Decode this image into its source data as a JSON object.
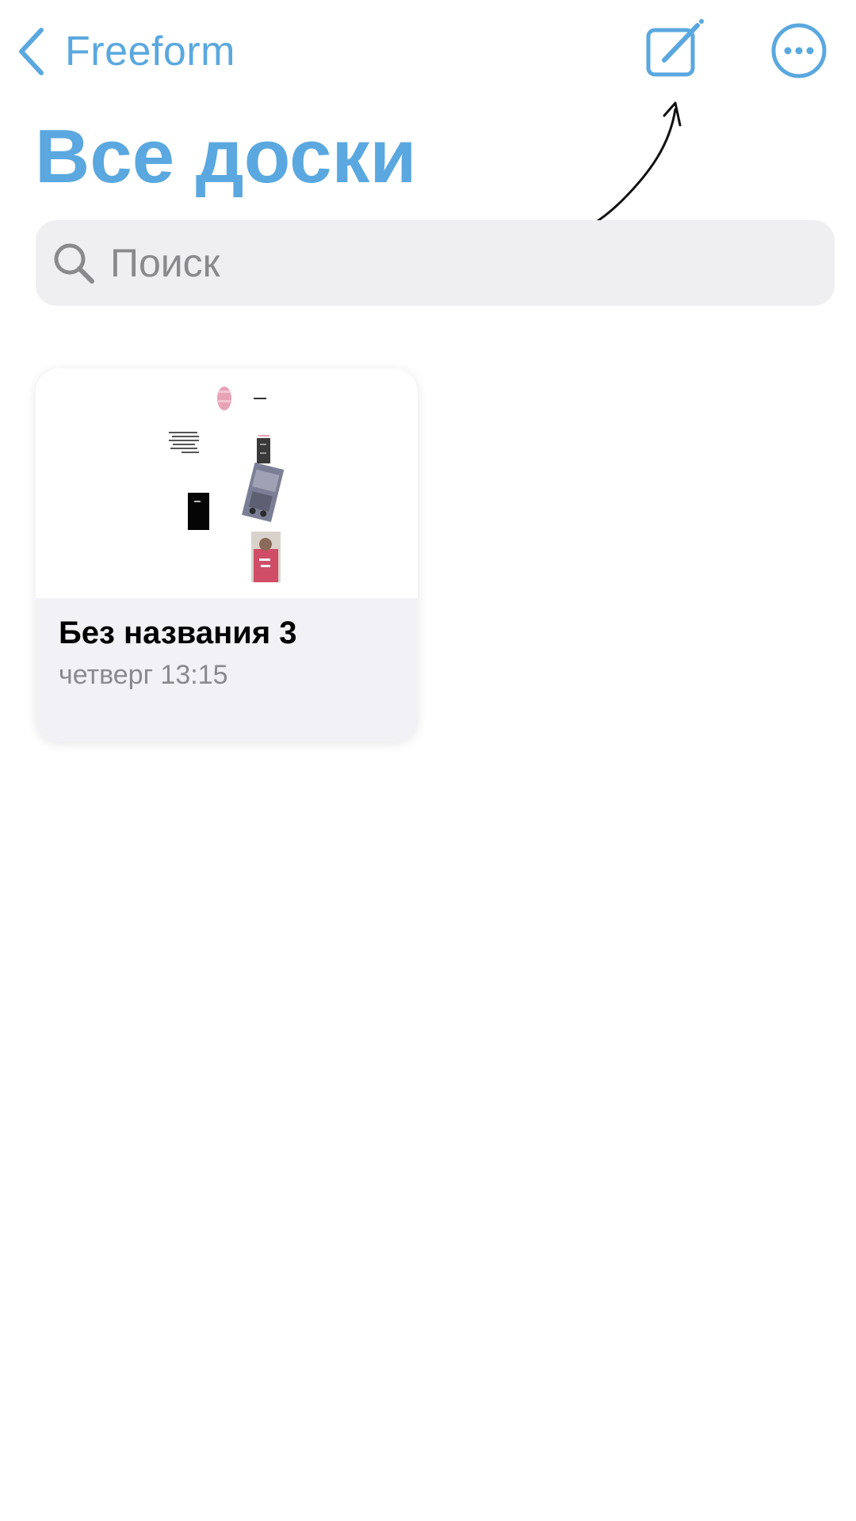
{
  "nav": {
    "back_label": "Freeform",
    "back_icon": "chevron-left-icon",
    "compose_icon": "compose-icon",
    "more_icon": "ellipsis-circle-icon"
  },
  "page": {
    "title": "Все доски"
  },
  "search": {
    "placeholder": "Поиск",
    "value": "",
    "icon": "search-icon"
  },
  "boards": [
    {
      "title": "Без названия 3",
      "date": "четверг 13:15"
    }
  ],
  "colors": {
    "accent": "#5aa8df",
    "search_bg": "#efeff1",
    "card_info_bg": "#f2f2f6",
    "secondary_text": "#8a8a8e"
  }
}
